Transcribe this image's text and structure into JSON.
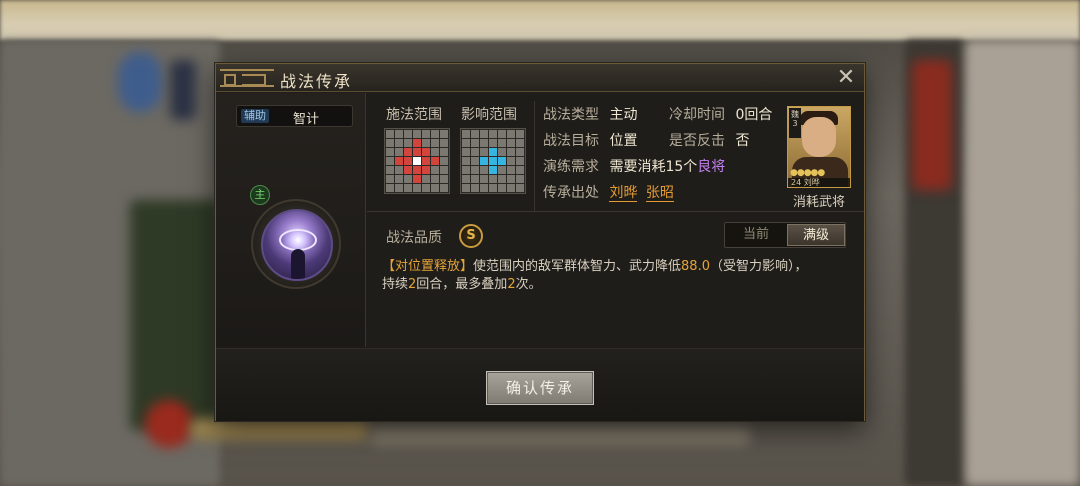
{
  "dialog": {
    "title": "战法传承",
    "close_label": "✕"
  },
  "skill": {
    "support_tag": "辅助",
    "name": "智计",
    "main_tag": "主"
  },
  "ranges": {
    "cast_label": "施法范围",
    "effect_label": "影响范围"
  },
  "info": {
    "type_label": "战法类型",
    "type_value": "主动",
    "cooldown_label": "冷却时间",
    "cooldown_value": "0回合",
    "target_label": "战法目标",
    "target_value": "位置",
    "counter_label": "是否反击",
    "counter_value": "否",
    "train_label": "演练需求",
    "train_prefix": "需要消耗",
    "train_count": "15个",
    "train_item": "良将",
    "source_label": "传承出处",
    "source_1": "刘晔",
    "source_2": "张昭"
  },
  "portrait": {
    "flag": "魏3",
    "stars": "●●●●●",
    "level_name": "24 刘晔",
    "caption": "消耗武将"
  },
  "quality": {
    "label": "战法品质",
    "grade": "S",
    "tab_current": "当前",
    "tab_max": "满级"
  },
  "description": {
    "tag": "【对位置释放】",
    "text_1": "使范围内的敌军群体智力、武力降低",
    "value": "88.0",
    "text_2": "（受智力影响），",
    "text_3": "持续",
    "turns": "2",
    "text_4": "回合，最多叠加",
    "stacks": "2",
    "text_5": "次。"
  },
  "footer": {
    "confirm_label": "确认传承"
  },
  "colors": {
    "cast_highlight": "#d2453d",
    "effect_highlight": "#36b5e3",
    "accent_gold": "#e39a32",
    "purple_item": "#c47ff0"
  }
}
